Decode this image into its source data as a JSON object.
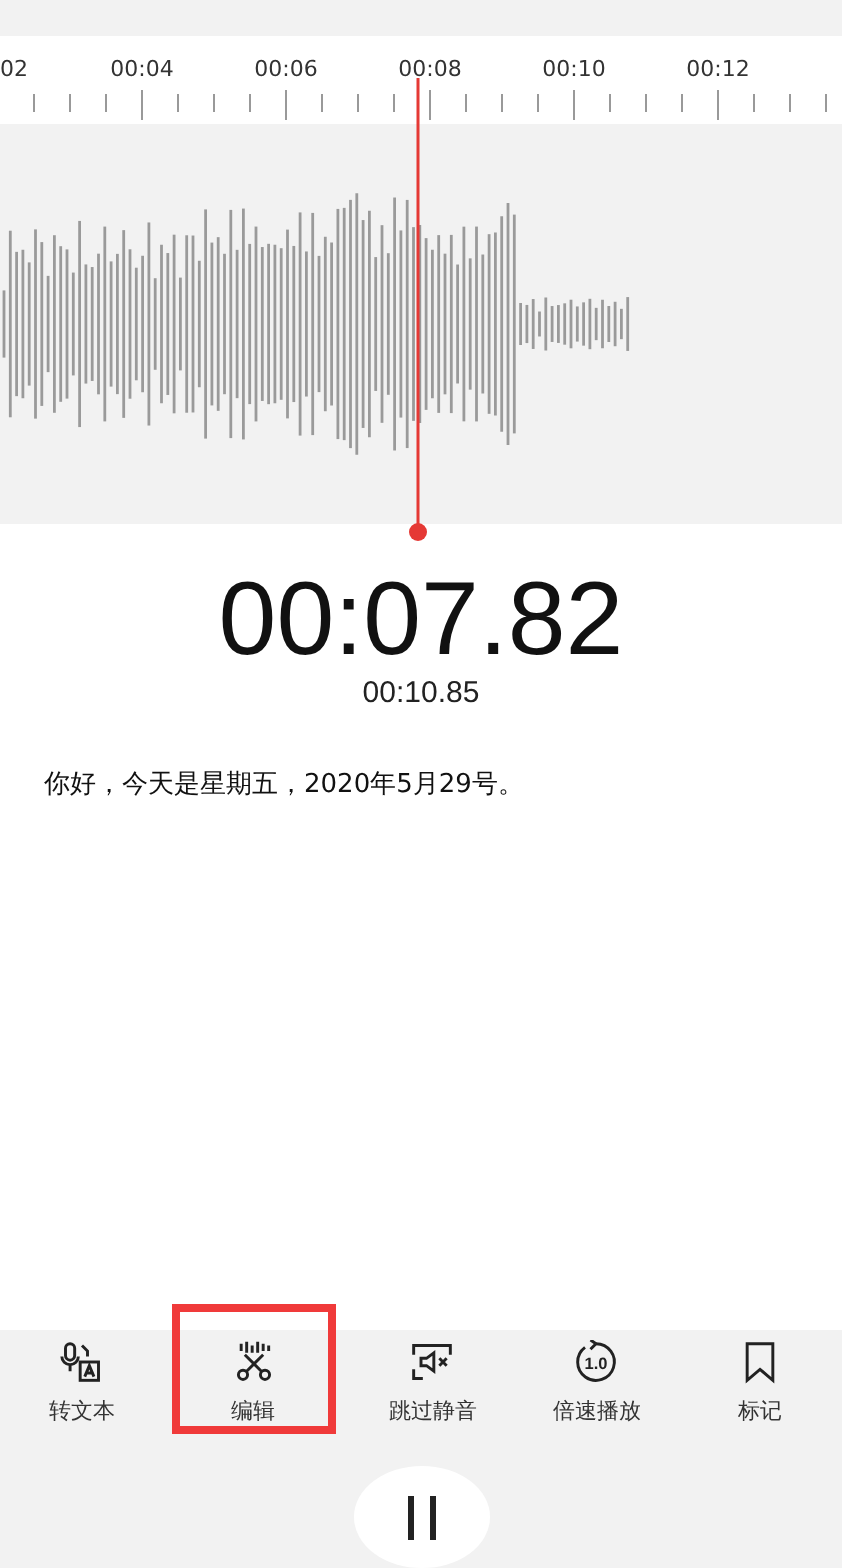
{
  "ruler": {
    "labels": [
      "02",
      "00:04",
      "00:06",
      "00:08",
      "00:10",
      "00:12"
    ]
  },
  "playback": {
    "current_time": "00:07.82",
    "total_time": "00:10.85"
  },
  "transcript": "你好，今天是星期五，2020年5月29号。",
  "toolbar": [
    {
      "kind": "transcribe",
      "label": "转文本",
      "highlighted": false
    },
    {
      "kind": "edit",
      "label": "编辑",
      "highlighted": true
    },
    {
      "kind": "skip-silence",
      "label": "跳过静音",
      "highlighted": false
    },
    {
      "kind": "speed",
      "label": "倍速播放",
      "icon_text": "1.0",
      "highlighted": false
    },
    {
      "kind": "bookmark",
      "label": "标记",
      "highlighted": false
    }
  ]
}
